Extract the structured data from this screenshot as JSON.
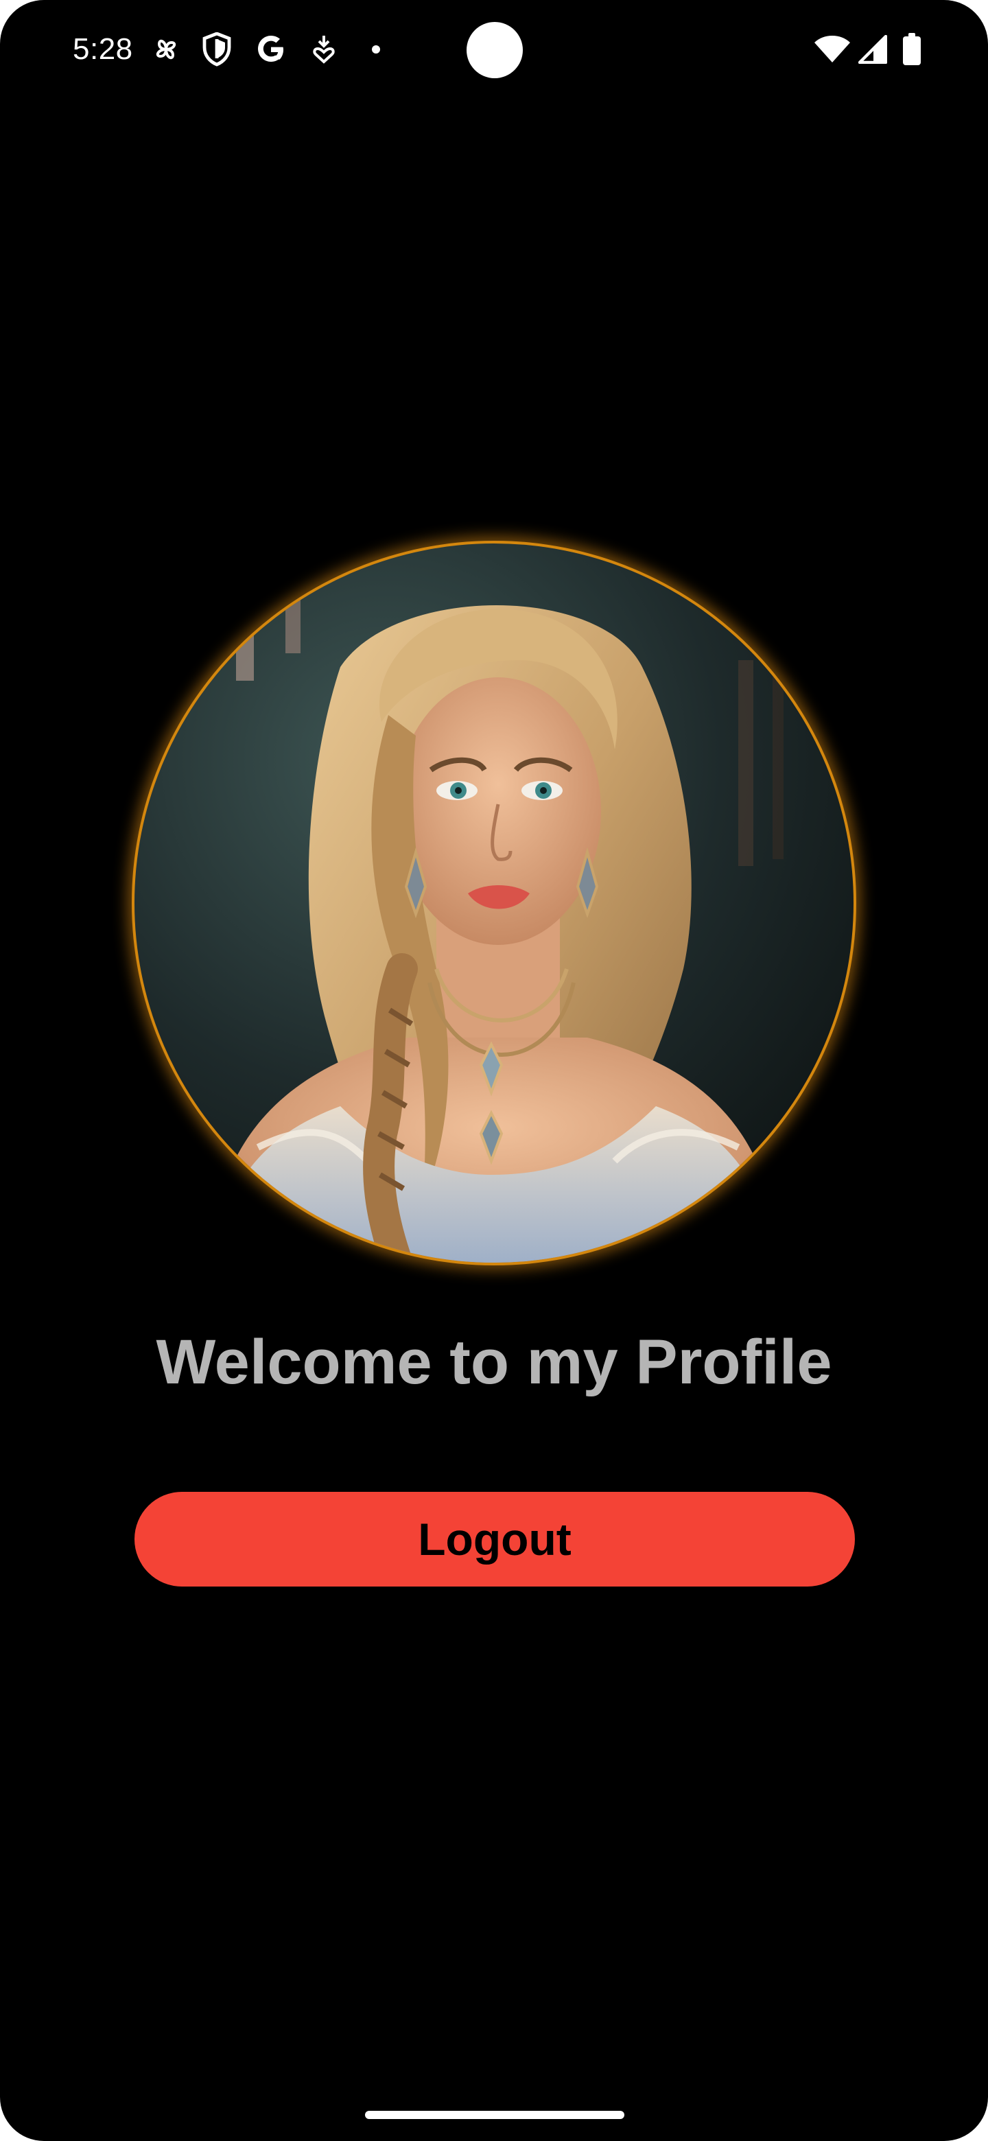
{
  "status_bar": {
    "time": "5:28",
    "left_icons": [
      "pinwheel-icon",
      "shield-icon",
      "google-g-icon",
      "download-heart-icon",
      "notification-dot-icon"
    ],
    "right_icons": [
      "wifi-icon",
      "cellular-signal-icon",
      "battery-icon"
    ]
  },
  "profile": {
    "image_description_icon": "profile-portrait-image",
    "welcome_text": "Welcome to my Profile",
    "logout_label": "Logout"
  },
  "colors": {
    "background": "#000000",
    "accent_ring": "#d4870e",
    "logout_button": "#f44336",
    "welcome_text": "#b5b5b5"
  }
}
